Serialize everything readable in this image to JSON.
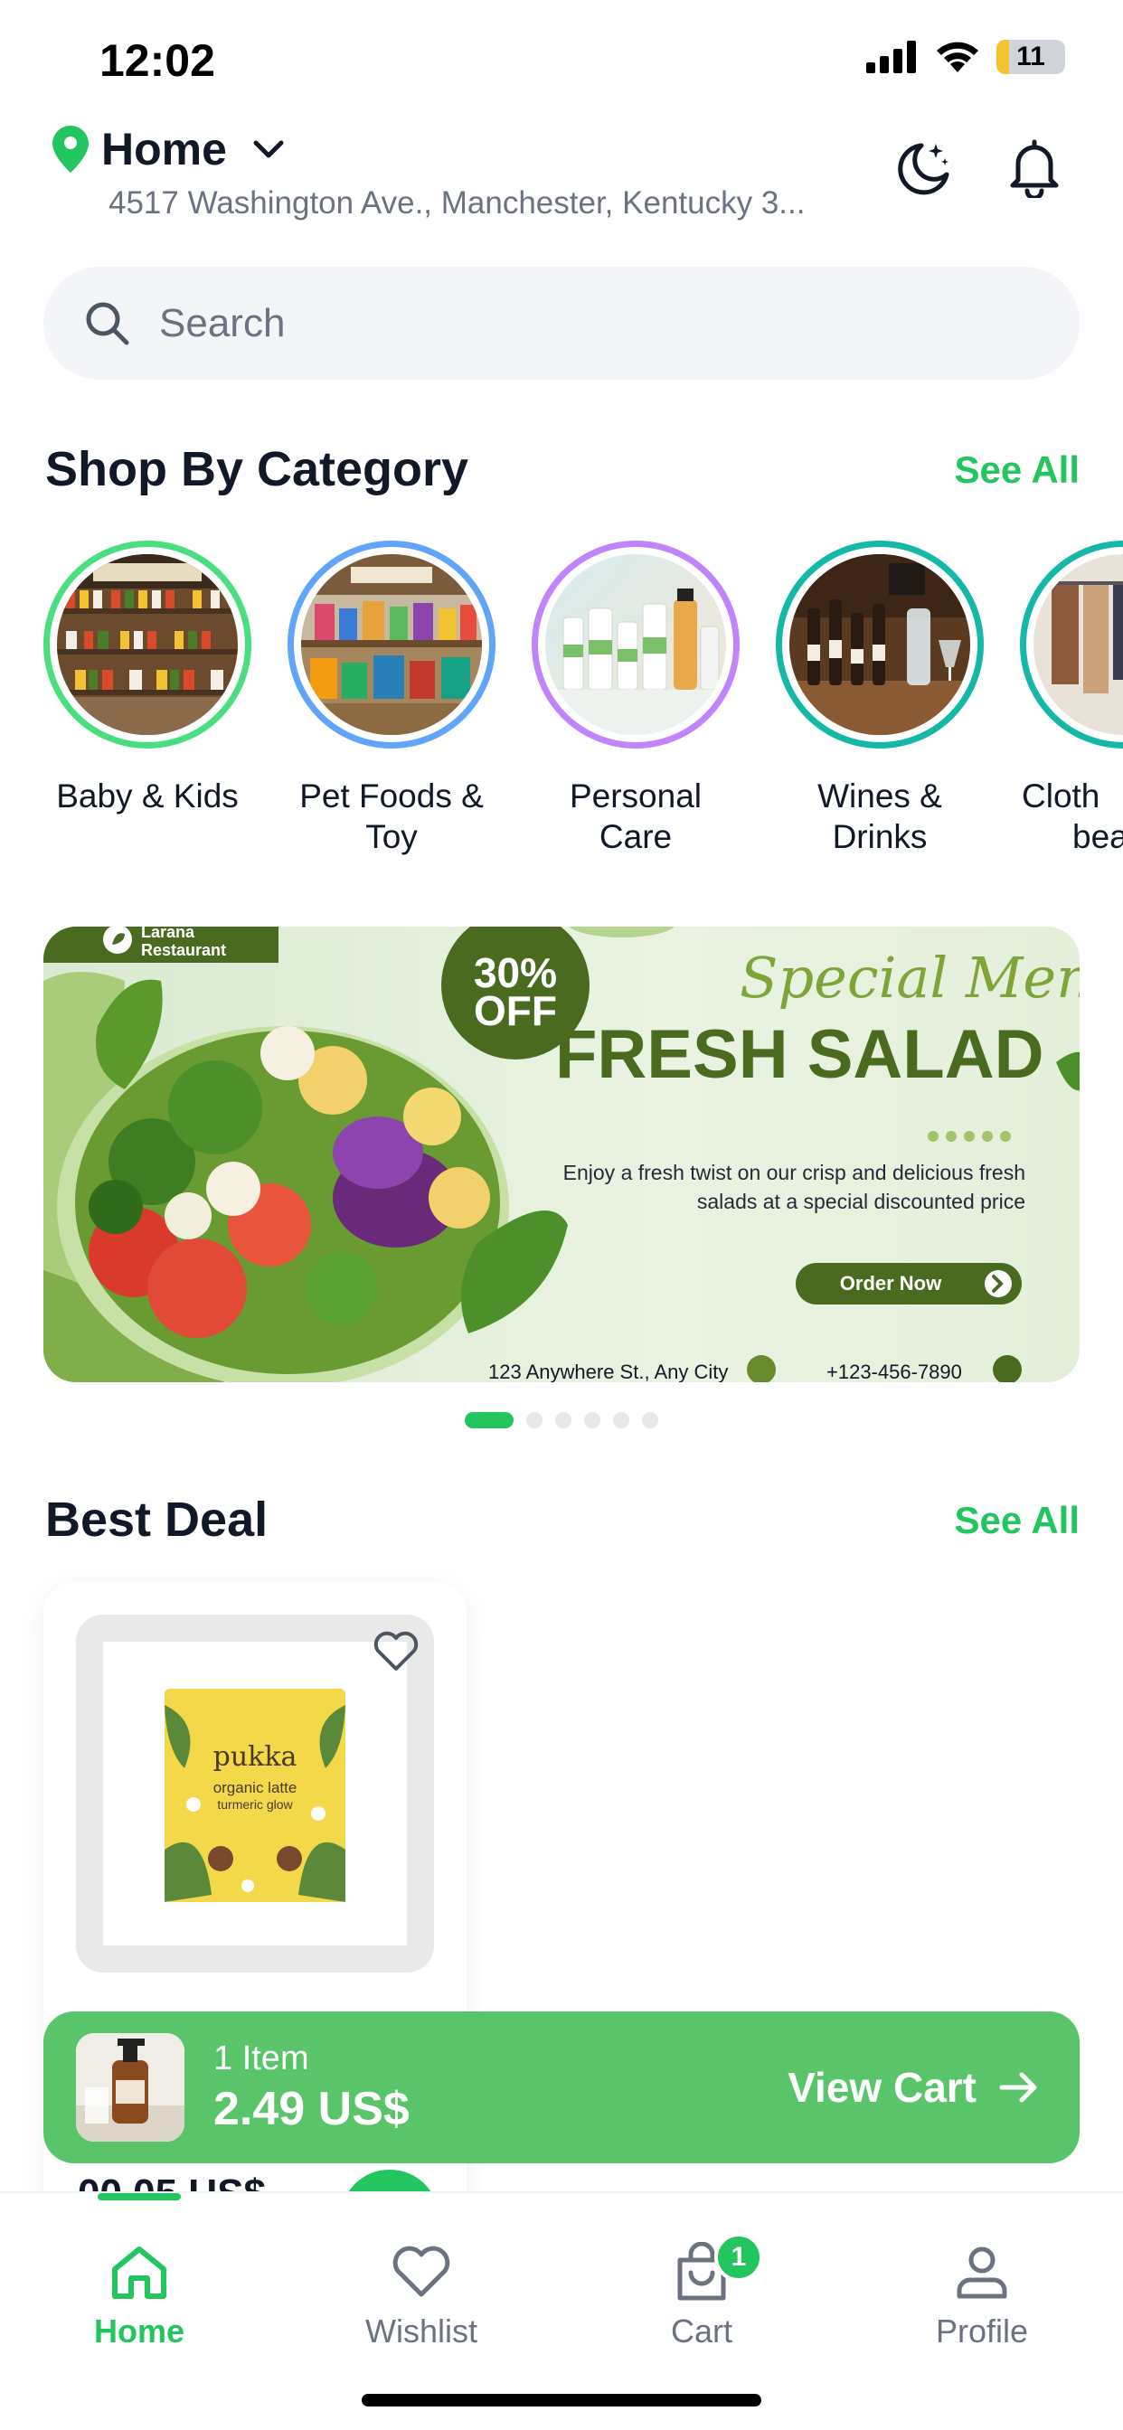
{
  "status_bar": {
    "time": "12:02",
    "battery": "11"
  },
  "header": {
    "location_label": "Home",
    "address": "4517 Washington Ave., Manchester, Kentucky 3..."
  },
  "search": {
    "placeholder": "Search"
  },
  "categories_section": {
    "title": "Shop By Category",
    "see_all": "See All",
    "items": [
      {
        "label_line1": "Baby & Kids",
        "label_line2": "",
        "ring_color": "#4ade80"
      },
      {
        "label_line1": "Pet Foods &",
        "label_line2": "Toy",
        "ring_color": "#60a5fa"
      },
      {
        "label_line1": "Personal",
        "label_line2": "Care",
        "ring_color": "#c084fc"
      },
      {
        "label_line1": "Wines &",
        "label_line2": "Drinks",
        "ring_color": "#14b8a6"
      },
      {
        "label_line1": "Cloth",
        "label_line2": "bea",
        "ring_color": "#14b8a6"
      }
    ]
  },
  "banner": {
    "brand": "Larana\nRestaurant",
    "discount_line1": "30%",
    "discount_line2": "OFF",
    "script_title": "Special Menu",
    "title": "FRESH SALAD",
    "description_line1": "Enjoy a fresh twist on our crisp and delicious fresh",
    "description_line2": "salads at a special discounted price",
    "cta": "Order Now",
    "address": "123 Anywhere St., Any City",
    "phone": "+123-456-7890",
    "active_slide": 1,
    "slide_count": 6
  },
  "best_deal_section": {
    "title": "Best Deal",
    "see_all": "See All",
    "product_price_partial": "00.05 US$",
    "product_package_brand": "pukka",
    "product_package_line1": "organic latte",
    "product_package_line2": "turmeric glow"
  },
  "cart_bar": {
    "item_count": "1 Item",
    "total": "2.49 US$",
    "action": "View Cart"
  },
  "tab_bar": {
    "tabs": [
      {
        "label": "Home",
        "active": true
      },
      {
        "label": "Wishlist",
        "active": false
      },
      {
        "label": "Cart",
        "active": false,
        "badge": "1"
      },
      {
        "label": "Profile",
        "active": false
      }
    ]
  },
  "colors": {
    "accent": "#22c55e",
    "cart_bar": "#5ac46b",
    "banner_green": "#4a6b1f"
  }
}
